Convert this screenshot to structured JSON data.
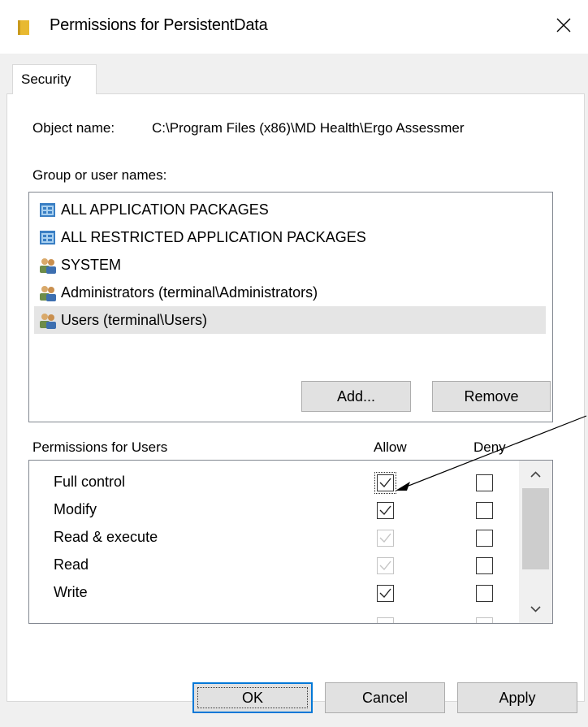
{
  "window": {
    "title": "Permissions for PersistentData",
    "icon": "folder-icon",
    "close_icon": "close-icon"
  },
  "tabs": [
    {
      "label": "Security",
      "active": true
    }
  ],
  "object": {
    "label": "Object name:",
    "value": "C:\\Program Files (x86)\\MD Health\\Ergo Assessmer"
  },
  "groups": {
    "label": "Group or user names:",
    "items": [
      {
        "label": "ALL APPLICATION PACKAGES",
        "icon": "app-package-icon"
      },
      {
        "label": "ALL RESTRICTED APPLICATION PACKAGES",
        "icon": "app-package-icon"
      },
      {
        "label": "SYSTEM",
        "icon": "users-group-icon"
      },
      {
        "label": "Administrators (terminal\\Administrators)",
        "icon": "users-group-icon"
      },
      {
        "label": "Users (terminal\\Users)",
        "icon": "users-group-icon",
        "selected": true
      }
    ]
  },
  "buttons": {
    "add": "Add...",
    "remove": "Remove",
    "ok": "OK",
    "cancel": "Cancel",
    "apply": "Apply"
  },
  "permissions": {
    "label": "Permissions for Users",
    "allow_header": "Allow",
    "deny_header": "Deny",
    "rows": [
      {
        "name": "Full control",
        "allow": "checked",
        "deny": "unchecked"
      },
      {
        "name": "Modify",
        "allow": "checked",
        "deny": "unchecked"
      },
      {
        "name": "Read & execute",
        "allow": "checked-disabled",
        "deny": "unchecked"
      },
      {
        "name": "Read",
        "allow": "checked-disabled",
        "deny": "unchecked"
      },
      {
        "name": "Write",
        "allow": "checked",
        "deny": "unchecked"
      }
    ]
  },
  "colors": {
    "accent": "#0078d7",
    "selection": "#e5e5e5",
    "dialog_bg": "#f0f0f0"
  }
}
